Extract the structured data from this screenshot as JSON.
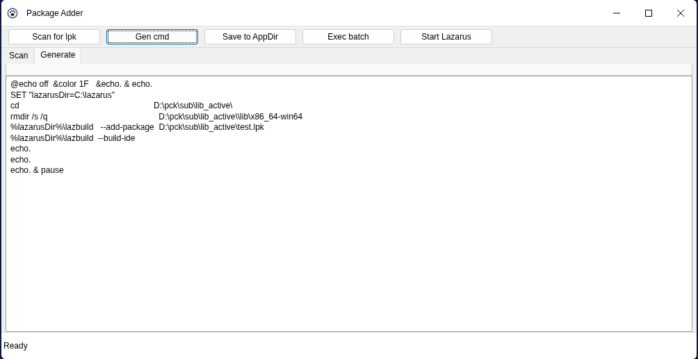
{
  "window": {
    "title": "Package Adder"
  },
  "toolbar": [
    {
      "label": "Scan for lpk",
      "focused": false
    },
    {
      "label": "Gen cmd",
      "focused": true
    },
    {
      "label": "Save to AppDir",
      "focused": false
    },
    {
      "label": "Exec batch",
      "focused": false
    },
    {
      "label": "Start Lazarus",
      "focused": false
    }
  ],
  "tabs": [
    {
      "label": "Scan",
      "selected": false
    },
    {
      "label": "Generate",
      "selected": true
    }
  ],
  "editor": {
    "lines": [
      "@echo off  &color 1F   &echo. & echo.",
      "SET \"lazarusDir=C:\\lazarus\"",
      "cd                                                          D:\\pck\\sub\\lib_active\\",
      "rmdir /s /q                                                D:\\pck\\sub\\lib_active\\\\lib\\x86_64-win64",
      "%lazarusDir%\\lazbuild   --add-package  D:\\pck\\sub\\lib_active\\test.lpk",
      "%lazarusDir%\\lazbuild  --build-ide",
      "echo.",
      "echo.",
      "echo. & pause"
    ]
  },
  "status_bar": "Ready"
}
